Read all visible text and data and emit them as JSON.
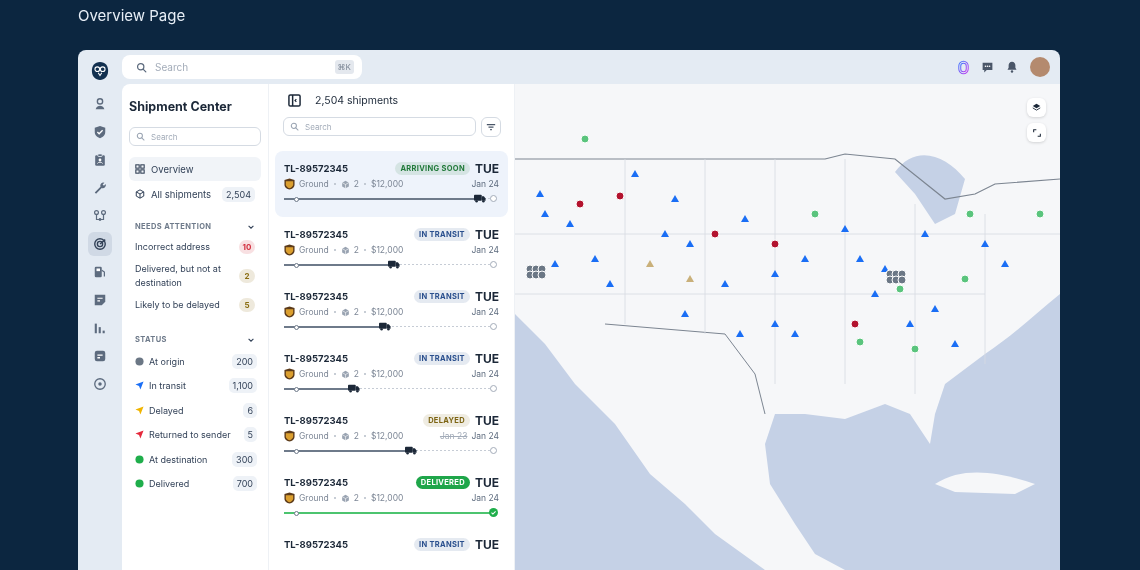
{
  "page_title": "Overview Page",
  "topbar": {
    "search": {
      "placeholder": "Search",
      "shortcut": "⌘K"
    }
  },
  "rail": {
    "items": [
      {
        "selected": false
      },
      {
        "selected": false
      },
      {
        "selected": false
      },
      {
        "selected": false
      },
      {
        "selected": false
      },
      {
        "selected": true
      },
      {
        "selected": false
      },
      {
        "selected": false
      },
      {
        "selected": false
      },
      {
        "selected": false
      },
      {
        "selected": false
      }
    ]
  },
  "sidebar": {
    "title": "Shipment Center",
    "search": {
      "placeholder": "Search"
    },
    "nav": [
      {
        "label": "Overview",
        "selected": true
      },
      {
        "label": "All shipments",
        "count": "2,504",
        "selected": false
      }
    ],
    "needs_attention": {
      "title": "NEEDS ATTENTION",
      "expanded": true,
      "items": [
        {
          "label": "Incorrect address",
          "count": "10",
          "color": "#d22f3e"
        },
        {
          "label": "Delivered, but not at destination",
          "count": "2",
          "color": "#8a6d12"
        },
        {
          "label": "Likely to be delayed",
          "count": "5",
          "color": "#8a6d12"
        }
      ]
    },
    "status": {
      "title": "STATUS",
      "expanded": true,
      "items": [
        {
          "label": "At origin",
          "count": "200",
          "kind": "dot",
          "color": "#6b7785"
        },
        {
          "label": "In transit",
          "count": "1,100",
          "kind": "arrow",
          "color": "#1a6ef5"
        },
        {
          "label": "Delayed",
          "count": "6",
          "kind": "arrow",
          "color": "#f0b400"
        },
        {
          "label": "Returned to sender",
          "count": "5",
          "kind": "arrow",
          "color": "#e5283b"
        },
        {
          "label": "At destination",
          "count": "300",
          "kind": "dot",
          "color": "#1fae4b"
        },
        {
          "label": "Delivered",
          "count": "700",
          "kind": "dot",
          "color": "#1fae4b"
        }
      ]
    }
  },
  "list": {
    "count_label": "2,504 shipments",
    "search": {
      "placeholder": "Search"
    },
    "shipments": [
      {
        "id": "TL-89572345",
        "service": "Ground",
        "packages": "2",
        "value": "$12,000",
        "status": "ARRIVING SOON",
        "color": "#227a3b",
        "day": "TUE",
        "date": "Jan 24",
        "level": 0.93,
        "selected": true
      },
      {
        "id": "TL-89572345",
        "service": "Ground",
        "packages": "2",
        "value": "$12,000",
        "status": "IN TRANSIT",
        "color": "#2a4f8d",
        "day": "TUE",
        "date": "Jan 24",
        "level": 0.52,
        "selected": false
      },
      {
        "id": "TL-89572345",
        "service": "Ground",
        "packages": "2",
        "value": "$12,000",
        "status": "IN TRANSIT",
        "color": "#2a4f8d",
        "day": "TUE",
        "date": "Jan 24",
        "level": 0.48,
        "selected": false
      },
      {
        "id": "TL-89572345",
        "service": "Ground",
        "packages": "2",
        "value": "$12,000",
        "status": "IN TRANSIT",
        "color": "#2a4f8d",
        "day": "TUE",
        "date": "Jan 24",
        "level": 0.33,
        "selected": false
      },
      {
        "id": "TL-89572345",
        "service": "Ground",
        "packages": "2",
        "value": "$12,000",
        "status": "DELAYED",
        "color": "#7d6413",
        "day": "TUE",
        "old_date": "Jan 23",
        "date": "Jan 24",
        "level": 0.6,
        "selected": false
      },
      {
        "id": "TL-89572345",
        "service": "Ground",
        "packages": "2",
        "value": "$12,000",
        "status": "DELIVERED",
        "color": "#1fa64a",
        "day": "TUE",
        "date": "Jan 24",
        "level": 1,
        "selected": false
      },
      {
        "id": "TL-89572345",
        "status": "IN TRANSIT",
        "color": "#2a4f8d",
        "day": "TUE",
        "selected": false
      }
    ]
  }
}
